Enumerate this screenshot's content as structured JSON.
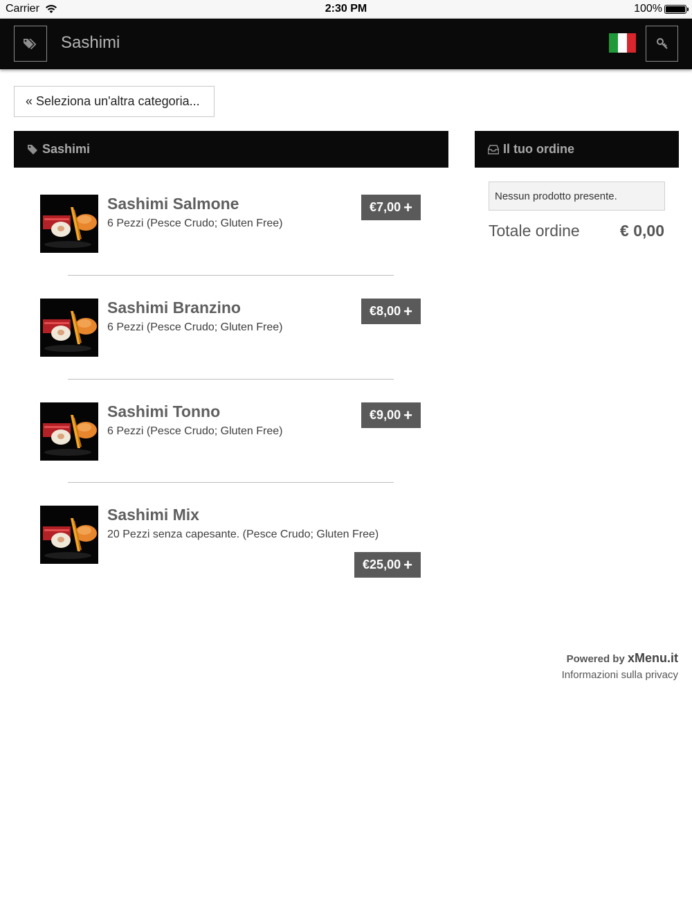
{
  "status_bar": {
    "carrier": "Carrier",
    "time": "2:30 PM",
    "battery": "100%"
  },
  "navbar": {
    "title": "Sashimi",
    "menu_icon": "tags-icon",
    "language_flag": "italy-flag-icon",
    "login_icon": "key-icon"
  },
  "back_button": {
    "label": "Seleziona un'altra categoria..."
  },
  "category": {
    "title": "Sashimi",
    "icon": "tag-icon"
  },
  "products": [
    {
      "name": "Sashimi Salmone",
      "description": "6 Pezzi (Pesce Crudo; Gluten Free)",
      "price": "€7,00"
    },
    {
      "name": "Sashimi Branzino",
      "description": "6 Pezzi (Pesce Crudo; Gluten Free)",
      "price": "€8,00"
    },
    {
      "name": "Sashimi Tonno",
      "description": "6 Pezzi (Pesce Crudo; Gluten Free)",
      "price": "€9,00"
    },
    {
      "name": "Sashimi Mix",
      "description": "20 Pezzi senza capesante. (Pesce Crudo; Gluten Free)",
      "price": "€25,00"
    }
  ],
  "order": {
    "title": "Il tuo ordine",
    "icon": "inbox-icon",
    "empty_message": "Nessun prodotto presente.",
    "total_label": "Totale ordine",
    "total_value": "€ 0,00"
  },
  "footer": {
    "powered_by": "Powered by",
    "brand": "xMenu.it",
    "privacy": "Informazioni sulla privacy"
  },
  "colors": {
    "navbar_bg": "#0a0a0a",
    "price_button_bg": "#5a5a5a",
    "header_text": "#a9a9a9"
  }
}
